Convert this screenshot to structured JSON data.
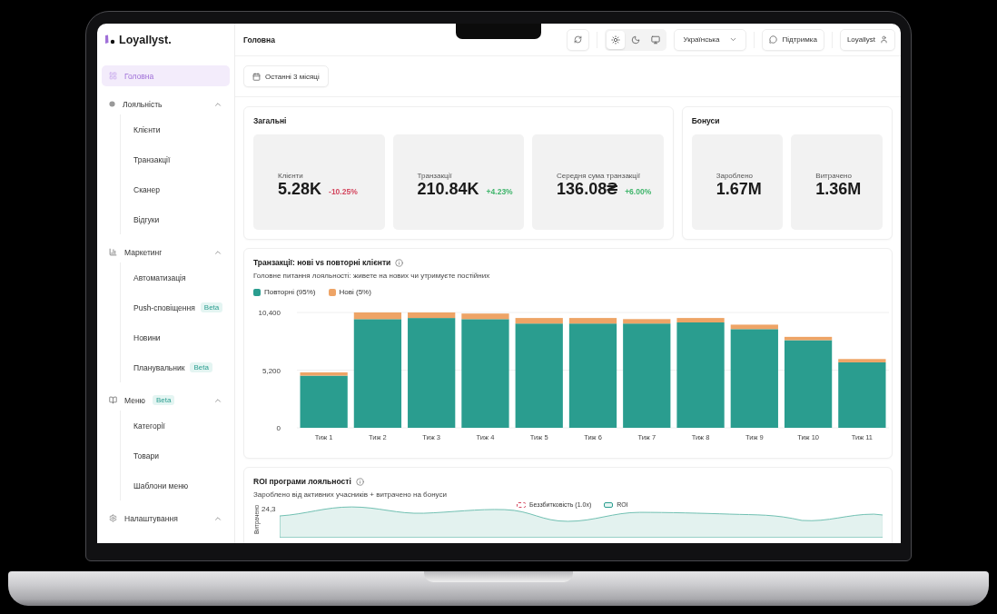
{
  "sidebar": {
    "logo": "Loyallyst.",
    "items": [
      {
        "label": "Головна",
        "selected": true
      },
      {
        "label": "Лояльність",
        "selected": false,
        "expanded": true,
        "children": [
          {
            "label": "Клієнти",
            "selected": false
          },
          {
            "label": "Транзакції",
            "selected": false
          },
          {
            "label": "Сканер",
            "selected": false
          },
          {
            "label": "Відгуки",
            "selected": false
          }
        ]
      },
      {
        "label": "Маркетинг",
        "selected": false,
        "expanded": true,
        "children": [
          {
            "label": "Автоматизація",
            "selected": false
          },
          {
            "label": "Push-сповіщення",
            "badge": "Beta",
            "selected": false
          },
          {
            "label": "Новини",
            "selected": false
          },
          {
            "label": "Планувальник",
            "badge": "Beta",
            "selected": false
          }
        ]
      },
      {
        "label": "Меню",
        "badge": "Beta",
        "selected": false,
        "expanded": true,
        "children": [
          {
            "label": "Категорії",
            "selected": false
          },
          {
            "label": "Товари",
            "selected": false
          },
          {
            "label": "Шаблони меню",
            "selected": false
          }
        ]
      },
      {
        "label": "Налаштування",
        "selected": false,
        "expanded": true
      }
    ]
  },
  "header": {
    "title": "Головна",
    "theme_options": [
      {
        "selected": true
      },
      {
        "selected": false
      },
      {
        "selected": false
      }
    ],
    "language": "Українська",
    "support": "Підтримка",
    "user": "Loyallyst"
  },
  "date_range": "Останні 3 місяці",
  "overview": {
    "title": "Загальні",
    "stats": [
      {
        "label": "Клієнти",
        "value": "5.28K",
        "change": "-10.25%",
        "color": "#d4475f"
      },
      {
        "label": "Транзакції",
        "value": "210.84K",
        "change": "+4.23%",
        "color": "#3fb56b"
      },
      {
        "label": "Середня сума транзакції",
        "value": "136.08₴",
        "change": "+6.00%",
        "color": "#3fb56b"
      }
    ]
  },
  "bonuses": {
    "title": "Бонуси",
    "stats": [
      {
        "label": "Зароблено",
        "value": "1.67M"
      },
      {
        "label": "Витрачено",
        "value": "1.36M"
      }
    ]
  },
  "transactions_chart": {
    "title": "Транзакції: нові vs повторні клієнти",
    "subtitle": "Головне питання лояльності: живете на нових чи утримуєте постійних",
    "chart_data": {
      "type": "bar",
      "stacked": true,
      "categories": [
        "Тиж 1",
        "Тиж 2",
        "Тиж 3",
        "Тиж 4",
        "Тиж 5",
        "Тиж 6",
        "Тиж 7",
        "Тиж 8",
        "Тиж 9",
        "Тиж 10",
        "Тиж 11"
      ],
      "series": [
        {
          "name": "Повторні (95%)",
          "color": "#2a9d8f",
          "values": [
            4700,
            9800,
            9900,
            9800,
            9400,
            9400,
            9400,
            9500,
            8900,
            7900,
            5900
          ]
        },
        {
          "name": "Нові (5%)",
          "color": "#eea466",
          "values": [
            300,
            600,
            500,
            500,
            500,
            500,
            400,
            400,
            400,
            300,
            300
          ]
        }
      ],
      "ylim": [
        0,
        10400
      ],
      "yticks": [
        {
          "value": 0,
          "label": "0"
        },
        {
          "value": 5200,
          "label": "5,200"
        },
        {
          "value": 10400,
          "label": "10,400"
        }
      ]
    }
  },
  "roi_chart": {
    "title": "ROI програми лояльності",
    "subtitle": "Зароблено від активних учасників + витрачено на бонуси",
    "ylabel": "Витрачено",
    "ytick": "24,3",
    "legend": [
      {
        "label": "Беззбитковість (1.0x)",
        "kind": "dashed"
      },
      {
        "label": "ROI",
        "kind": "solid"
      }
    ]
  }
}
